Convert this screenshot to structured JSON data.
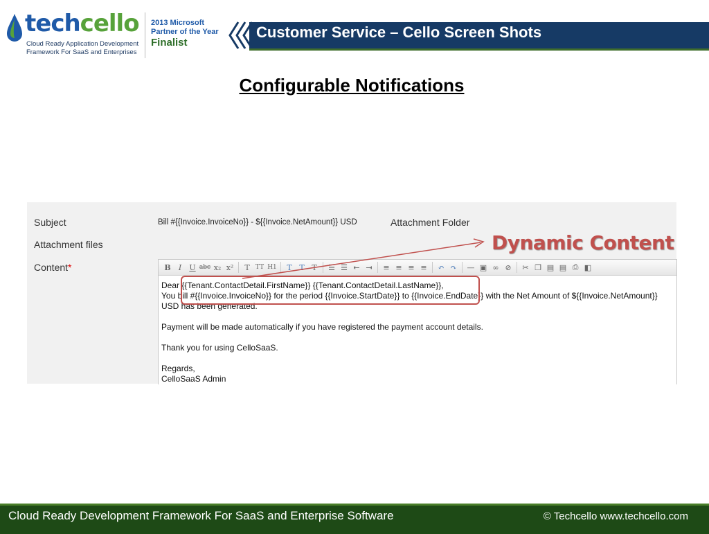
{
  "header": {
    "logo_word_a": "tech",
    "logo_word_b": "cello",
    "logo_tagline_1": "Cloud Ready Application Development",
    "logo_tagline_2": "Framework For SaaS and Enterprises",
    "award_line_1": "2013 Microsoft",
    "award_line_2": "Partner of the Year",
    "award_line_3": "Finalist",
    "title": "Customer Service – Cello Screen Shots"
  },
  "slide_title": "Configurable Notifications",
  "form": {
    "subject_label": "Subject",
    "subject_value": "Bill #{{Invoice.InvoiceNo}} - ${{Invoice.NetAmount}} USD",
    "attachment_folder_label": "Attachment Folder",
    "attachment_files_label": "Attachment files",
    "content_label": "Content",
    "required_mark": "*"
  },
  "editor": {
    "toolbar_glyphs": {
      "bold": "B",
      "italic": "I",
      "underline": "U",
      "strike": "abc",
      "subscript": "x₂",
      "superscript": "x²",
      "font": "T",
      "font_size": "TT",
      "heading": "H1"
    },
    "lines": [
      "Dear {{Tenant.ContactDetail.FirstName}} {{Tenant.ContactDetail.LastName}},",
      "You bill #{{Invoice.InvoiceNo}} for the period {{Invoice.StartDate}} to {{Invoice.EndDate}} with the Net Amount of ${{Invoice.NetAmount}}",
      "USD has been generated.",
      "",
      "Payment will be made automatically if you have registered the payment account details.",
      "",
      "Thank you for using CelloSaaS.",
      "",
      "Regards,",
      "CelloSaaS Admin"
    ]
  },
  "annotation": {
    "label": "Dynamic Content",
    "color": "#c0504d"
  },
  "footer": {
    "left": "Cloud Ready Development Framework For SaaS and Enterprise Software",
    "right": "© Techcello www.techcello.com"
  },
  "colors": {
    "title_bar": "#163a65",
    "footer": "#1e4a16",
    "accent_green": "#57a23a",
    "accent_blue": "#1f5aa8"
  }
}
